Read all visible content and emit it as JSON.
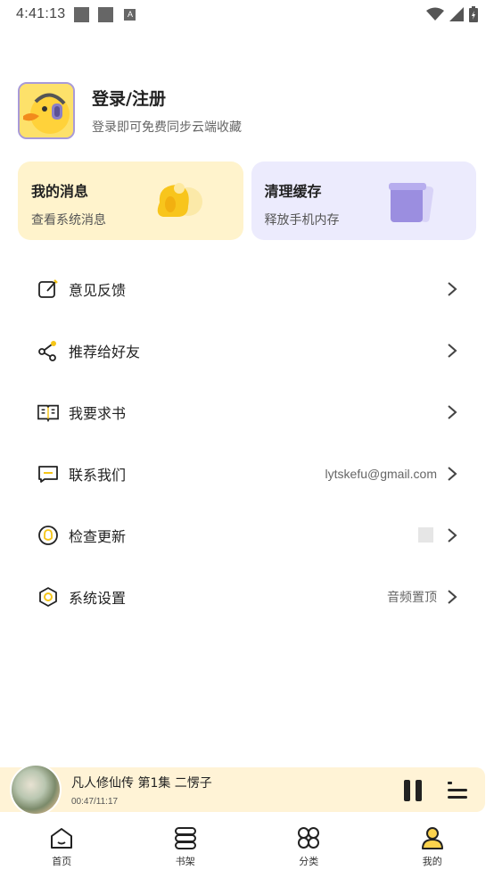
{
  "status_bar": {
    "time": "4:41:13",
    "badge_letter": "A"
  },
  "profile": {
    "title": "登录/注册",
    "subtitle": "登录即可免费同步云端收藏"
  },
  "cards": [
    {
      "title": "我的消息",
      "subtitle": "查看系统消息",
      "color": "#fff3cc"
    },
    {
      "title": "清理缓存",
      "subtitle": "释放手机内存",
      "color": "#ecebfd"
    }
  ],
  "menu": [
    {
      "label": "意见反馈",
      "icon": "edit-icon",
      "value": ""
    },
    {
      "label": "推荐给好友",
      "icon": "share-icon",
      "value": ""
    },
    {
      "label": "我要求书",
      "icon": "book-open-icon",
      "value": ""
    },
    {
      "label": "联系我们",
      "icon": "chat-icon",
      "value": "lytskefu@gmail.com"
    },
    {
      "label": "检查更新",
      "icon": "update-icon",
      "value": ""
    },
    {
      "label": "系统设置",
      "icon": "settings-icon",
      "value": "音频置顶"
    }
  ],
  "player": {
    "title": "凡人修仙传 第1集 二愣子",
    "time": "00:47/11:17"
  },
  "nav": [
    {
      "label": "首页",
      "icon": "home-icon",
      "active": false
    },
    {
      "label": "书架",
      "icon": "bookshelf-icon",
      "active": false
    },
    {
      "label": "分类",
      "icon": "category-icon",
      "active": false
    },
    {
      "label": "我的",
      "icon": "profile-icon",
      "active": true
    }
  ],
  "colors": {
    "accent_yellow": "#fcd34d",
    "accent_purple": "#a89ad8",
    "text_primary": "#222222"
  }
}
